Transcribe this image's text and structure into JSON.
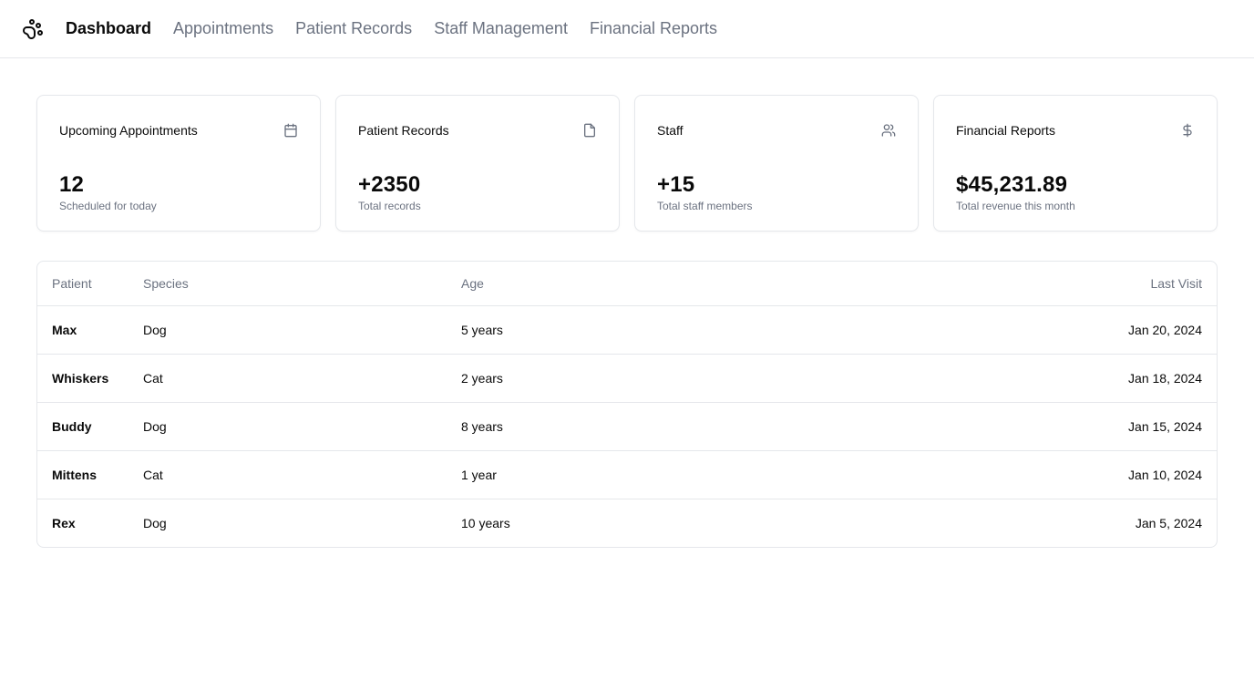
{
  "nav": {
    "logo_icon": "paw-icon",
    "links": [
      {
        "label": "Dashboard",
        "active": true
      },
      {
        "label": "Appointments",
        "active": false
      },
      {
        "label": "Patient Records",
        "active": false
      },
      {
        "label": "Staff Management",
        "active": false
      },
      {
        "label": "Financial Reports",
        "active": false
      }
    ]
  },
  "cards": [
    {
      "title": "Upcoming Appointments",
      "icon": "calendar-icon",
      "value": "12",
      "subtitle": "Scheduled for today"
    },
    {
      "title": "Patient Records",
      "icon": "file-icon",
      "value": "+2350",
      "subtitle": "Total records"
    },
    {
      "title": "Staff",
      "icon": "users-icon",
      "value": "+15",
      "subtitle": "Total staff members"
    },
    {
      "title": "Financial Reports",
      "icon": "dollar-icon",
      "value": "$45,231.89",
      "subtitle": "Total revenue this month"
    }
  ],
  "table": {
    "headers": [
      "Patient",
      "Species",
      "Age",
      "Last Visit"
    ],
    "rows": [
      {
        "patient": "Max",
        "species": "Dog",
        "age": "5 years",
        "last_visit": "Jan 20, 2024"
      },
      {
        "patient": "Whiskers",
        "species": "Cat",
        "age": "2 years",
        "last_visit": "Jan 18, 2024"
      },
      {
        "patient": "Buddy",
        "species": "Dog",
        "age": "8 years",
        "last_visit": "Jan 15, 2024"
      },
      {
        "patient": "Mittens",
        "species": "Cat",
        "age": "1 year",
        "last_visit": "Jan 10, 2024"
      },
      {
        "patient": "Rex",
        "species": "Dog",
        "age": "10 years",
        "last_visit": "Jan 5, 2024"
      }
    ]
  },
  "colors": {
    "text": "#0a0a0a",
    "muted": "#6b7280",
    "border": "#e5e7eb"
  }
}
